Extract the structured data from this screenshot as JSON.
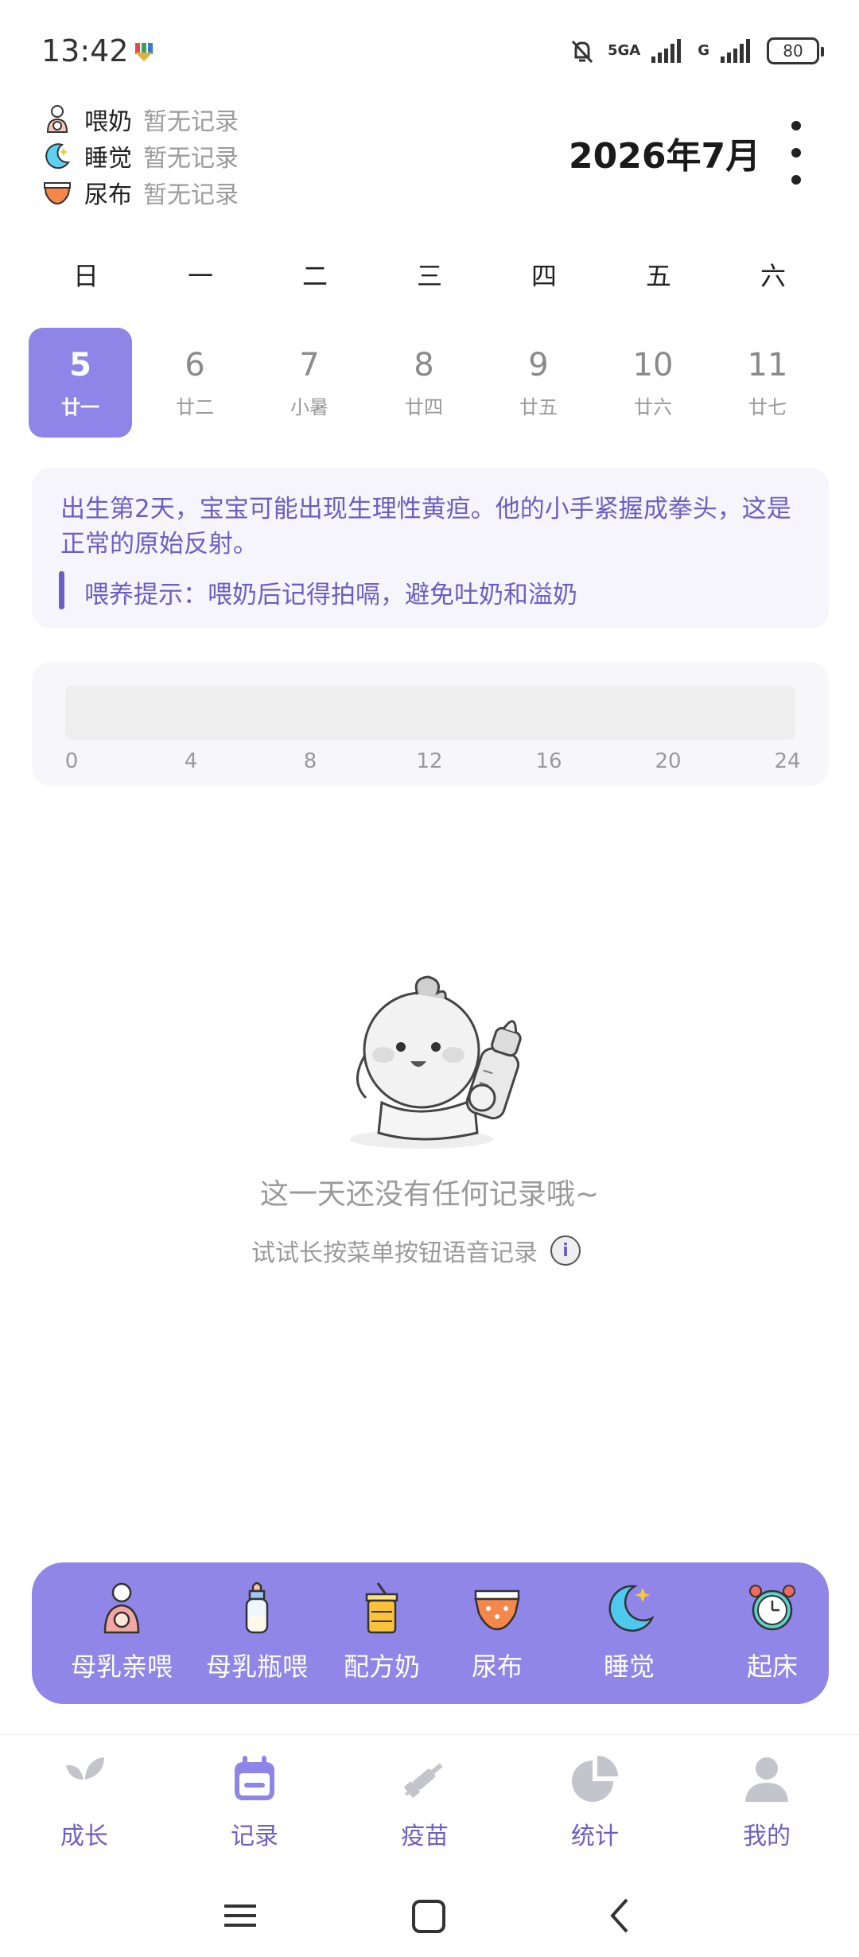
{
  "status_bar": {
    "time": "13:42",
    "network_1": "5GA",
    "network_2": "G",
    "battery": "80"
  },
  "summary": [
    {
      "label": "喂奶",
      "status": "暂无记录",
      "icon": "feeding-icon"
    },
    {
      "label": "睡觉",
      "status": "暂无记录",
      "icon": "moon-icon"
    },
    {
      "label": "尿布",
      "status": "暂无记录",
      "icon": "diaper-icon"
    }
  ],
  "header": {
    "month_title": "2026年7月"
  },
  "week": {
    "weekdays": [
      "日",
      "一",
      "二",
      "三",
      "四",
      "五",
      "六"
    ],
    "days": [
      {
        "num": "5",
        "lunar": "廿一",
        "selected": true
      },
      {
        "num": "6",
        "lunar": "廿二"
      },
      {
        "num": "7",
        "lunar": "小暑"
      },
      {
        "num": "8",
        "lunar": "廿四"
      },
      {
        "num": "9",
        "lunar": "廿五"
      },
      {
        "num": "10",
        "lunar": "廿六"
      },
      {
        "num": "11",
        "lunar": "廿七"
      }
    ]
  },
  "tip": {
    "text": "出生第2天，宝宝可能出现生理性黄疸。他的小手紧握成拳头，这是正常的原始反射。",
    "feeding": "喂养提示：喂奶后记得拍嗝，避免吐奶和溢奶"
  },
  "timeline": {
    "ticks": [
      "0",
      "4",
      "8",
      "12",
      "16",
      "20",
      "24"
    ]
  },
  "empty": {
    "title": "这一天还没有任何记录哦~",
    "hint": "试试长按菜单按钮语音记录",
    "info_symbol": "i"
  },
  "quick_actions": [
    {
      "label": "母乳亲喂",
      "icon": "breastfeed-icon"
    },
    {
      "label": "母乳瓶喂",
      "icon": "bottle-icon"
    },
    {
      "label": "配方奶",
      "icon": "formula-icon"
    },
    {
      "label": "尿布",
      "icon": "diaper-icon"
    },
    {
      "label": "睡觉",
      "icon": "moon-icon"
    },
    {
      "label": "起床",
      "icon": "alarm-clock-icon"
    }
  ],
  "nav": [
    {
      "label": "成长",
      "icon": "leaf-icon"
    },
    {
      "label": "记录",
      "icon": "calendar-icon",
      "active": true
    },
    {
      "label": "疫苗",
      "icon": "syringe-icon"
    },
    {
      "label": "统计",
      "icon": "pie-chart-icon"
    },
    {
      "label": "我的",
      "icon": "user-icon"
    }
  ],
  "colors": {
    "accent": "#8d85e8",
    "accent_text": "#6c5fc4",
    "inactive_icon": "#c4c4cc"
  }
}
